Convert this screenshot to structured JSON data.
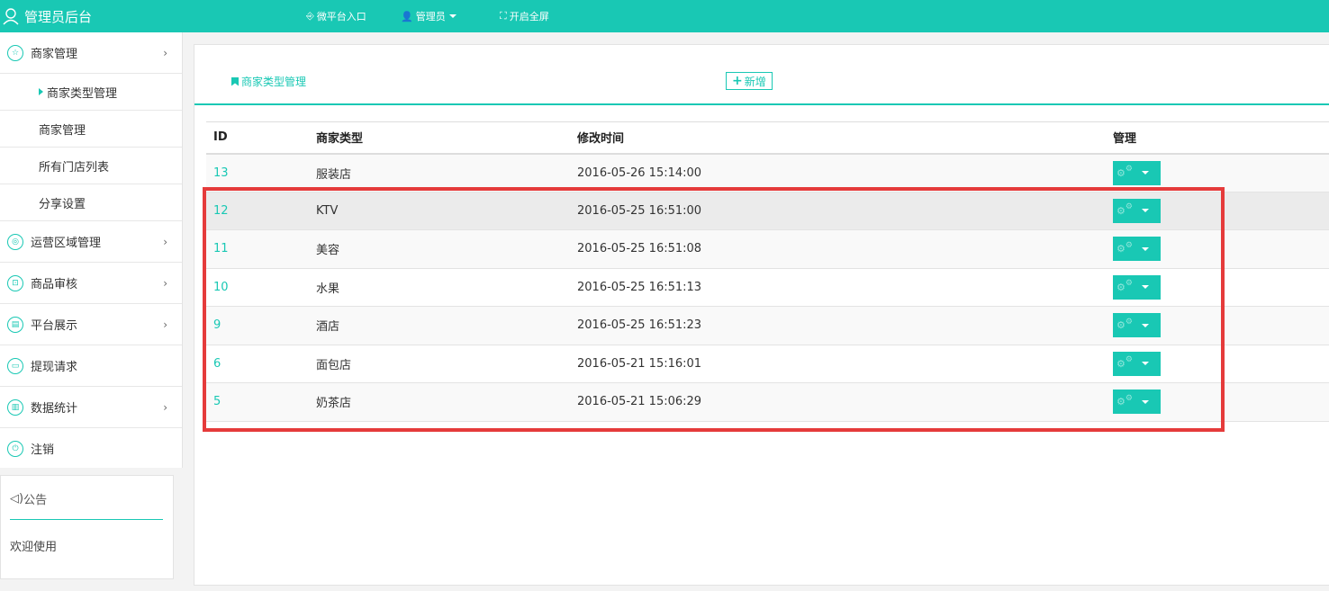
{
  "topbar": {
    "title": "管理员后台",
    "nav": [
      {
        "icon": "⎆",
        "label": "微平台入口"
      },
      {
        "icon": "👤",
        "label": "管理员"
      },
      {
        "icon": "⛶",
        "label": "开启全屏"
      }
    ]
  },
  "sidebar": {
    "sections": [
      {
        "icon": "☆",
        "label": "商家管理",
        "arrow": "›"
      },
      {
        "icon": "◎",
        "label": "运营区域管理",
        "arrow": "›"
      },
      {
        "icon": "⊡",
        "label": "商品审核",
        "arrow": "›"
      },
      {
        "icon": "▤",
        "label": "平台展示",
        "arrow": "›"
      },
      {
        "icon": "▭",
        "label": "提现请求"
      },
      {
        "icon": "▥",
        "label": "数据统计",
        "arrow": "›"
      },
      {
        "icon": "⏻",
        "label": "注销"
      }
    ],
    "subitems": [
      "商家类型管理",
      "商家管理",
      "所有门店列表",
      "分享设置"
    ],
    "notice": {
      "icon": "◁)",
      "title": "公告",
      "text": "欢迎使用"
    }
  },
  "main": {
    "tab_label": "商家类型管理",
    "add_label": "新增",
    "add_icon": "+",
    "columns": [
      "ID",
      "商家类型",
      "修改时间",
      "管理"
    ],
    "rows": [
      {
        "id": "13",
        "type": "服装店",
        "time": "2016-05-26 15:14:00"
      },
      {
        "id": "12",
        "type": "KTV",
        "time": "2016-05-25 16:51:00"
      },
      {
        "id": "11",
        "type": "美容",
        "time": "2016-05-25 16:51:08"
      },
      {
        "id": "10",
        "type": "水果",
        "time": "2016-05-25 16:51:13"
      },
      {
        "id": "9",
        "type": "酒店",
        "time": "2016-05-25 16:51:23"
      },
      {
        "id": "6",
        "type": "面包店",
        "time": "2016-05-21 15:16:01"
      },
      {
        "id": "5",
        "type": "奶茶店",
        "time": "2016-05-21 15:06:29"
      }
    ]
  },
  "colors": {
    "accent": "#19c8b4",
    "highlight_box": "#e53b3b"
  }
}
